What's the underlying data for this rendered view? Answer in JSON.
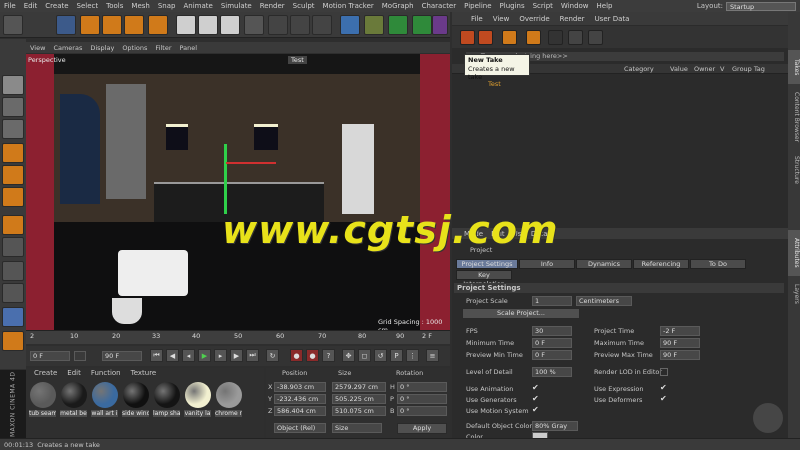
{
  "menubar": {
    "items": [
      "File",
      "Edit",
      "Create",
      "Select",
      "Tools",
      "Mesh",
      "Snap",
      "Animate",
      "Simulate",
      "Render",
      "Sculpt",
      "Motion Tracker",
      "MoGraph",
      "Character",
      "Pipeline",
      "Plugins",
      "Script",
      "Window",
      "Help"
    ],
    "layout_label": "Layout:",
    "layout_value": "Startup"
  },
  "viewport": {
    "menu": [
      "View",
      "Cameras",
      "Display",
      "Options",
      "Filter",
      "Panel"
    ],
    "label": "Perspective",
    "take_badge": "Test",
    "grid_spacing": "Grid Spacing : 1000 cm"
  },
  "timeline": {
    "ticks": [
      "2",
      "10",
      "20",
      "33",
      "40",
      "50",
      "60",
      "70",
      "80",
      "90"
    ],
    "frame": "2 F"
  },
  "transport": {
    "start": "0 F",
    "current": "0 F",
    "end": "90 F",
    "end2": "90 F"
  },
  "materials": {
    "menu": [
      "Create",
      "Edit",
      "Function",
      "Texture"
    ],
    "items": [
      {
        "label": "tub seam",
        "color": "#5a5a5a"
      },
      {
        "label": "metal be",
        "color": "#1a1a1a"
      },
      {
        "label": "wall art i",
        "color": "#3a6aa0"
      },
      {
        "label": "side wind",
        "color": "#101010"
      },
      {
        "label": "lamp sha",
        "color": "#141414"
      },
      {
        "label": "vanity la",
        "color": "#f2f0d0"
      },
      {
        "label": "chrome r",
        "color": "#9a9a9a"
      }
    ]
  },
  "coords": {
    "headers": [
      "Position",
      "Size",
      "Rotation"
    ],
    "rows": [
      {
        "axis": "X",
        "pos": "-38.903 cm",
        "size": "2579.297 cm",
        "rot_axis": "H",
        "rot": "0 °"
      },
      {
        "axis": "Y",
        "pos": "-232.436 cm",
        "size": "505.225 cm",
        "rot_axis": "P",
        "rot": "0 °"
      },
      {
        "axis": "Z",
        "pos": "586.404 cm",
        "size": "510.075 cm",
        "rot_axis": "B",
        "rot": "0 °"
      }
    ],
    "mode": "Object (Rel)",
    "size_mode": "Size",
    "apply": "Apply"
  },
  "status": {
    "time": "00:01:13",
    "message": "Creates a new take"
  },
  "maxon": "MAXON CINEMA 4D",
  "takes": {
    "menu": [
      "File",
      "View",
      "Override",
      "Render",
      "User Data"
    ],
    "search": "<<Type search string here>>",
    "columns": [
      "Category",
      "Value",
      "Owner",
      "V",
      "Group Tag"
    ],
    "item": "Test",
    "tooltip_title": "New Take",
    "tooltip_desc": "Creates a new take"
  },
  "attributes": {
    "menu": [
      "Mode",
      "Edit",
      "User Data"
    ],
    "section": "Project",
    "tabs": [
      "Project Settings",
      "Info",
      "Dynamics",
      "Referencing",
      "To Do"
    ],
    "tab2": "Key Interpolation",
    "heading": "Project Settings",
    "scale_label": "Project Scale",
    "scale_value": "1",
    "scale_unit": "Centimeters",
    "scale_button": "Scale Project...",
    "fps_label": "FPS",
    "fps": "30",
    "project_time_label": "Project Time",
    "project_time": "-2 F",
    "min_time_label": "Minimum Time",
    "min_time": "0 F",
    "max_time_label": "Maximum Time",
    "max_time": "90 F",
    "prev_min_label": "Preview Min Time",
    "prev_min": "0 F",
    "prev_max_label": "Preview Max Time",
    "prev_max": "90 F",
    "lod_label": "Level of Detail",
    "lod": "100 %",
    "render_lod_label": "Render LOD in Editor",
    "use_anim": "Use Animation",
    "use_expr": "Use Expression",
    "use_gen": "Use Generators",
    "use_def": "Use Deformers",
    "use_motion": "Use Motion System",
    "def_color_label": "Default Object Color",
    "def_color": "80% Gray",
    "color_label": "Color"
  },
  "right_tabs": [
    "Takes",
    "Content Browser",
    "Structure",
    "Attributes",
    "Layers"
  ],
  "watermark": "www.cgtsj.com"
}
